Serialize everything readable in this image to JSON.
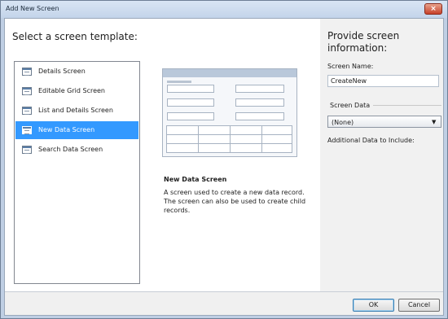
{
  "window": {
    "title": "Add New Screen",
    "close_glyph": "×"
  },
  "left": {
    "heading": "Select a screen template:",
    "templates": [
      {
        "label": "Details Screen",
        "icon": "details-screen-icon",
        "selected": false
      },
      {
        "label": "Editable Grid Screen",
        "icon": "grid-screen-icon",
        "selected": false
      },
      {
        "label": "List and Details Screen",
        "icon": "list-details-screen-icon",
        "selected": false
      },
      {
        "label": "New Data Screen",
        "icon": "new-data-screen-icon",
        "selected": true
      },
      {
        "label": "Search Data Screen",
        "icon": "search-data-screen-icon",
        "selected": false
      }
    ],
    "description": {
      "title": "New Data Screen",
      "body": "A screen used to create a new data record. The screen can also be used to create child records."
    }
  },
  "right": {
    "heading": "Provide screen information:",
    "screen_name_label": "Screen Name:",
    "screen_name_value": "CreateNew",
    "screen_data_label": "Screen Data",
    "screen_data_value": "(None)",
    "additional_label": "Additional Data to Include:"
  },
  "footer": {
    "ok_label": "OK",
    "cancel_label": "Cancel"
  },
  "colors": {
    "selection": "#3399ff",
    "titlebar": "#c3d4ea",
    "close": "#c7412a",
    "panel": "#f1f1f1"
  }
}
